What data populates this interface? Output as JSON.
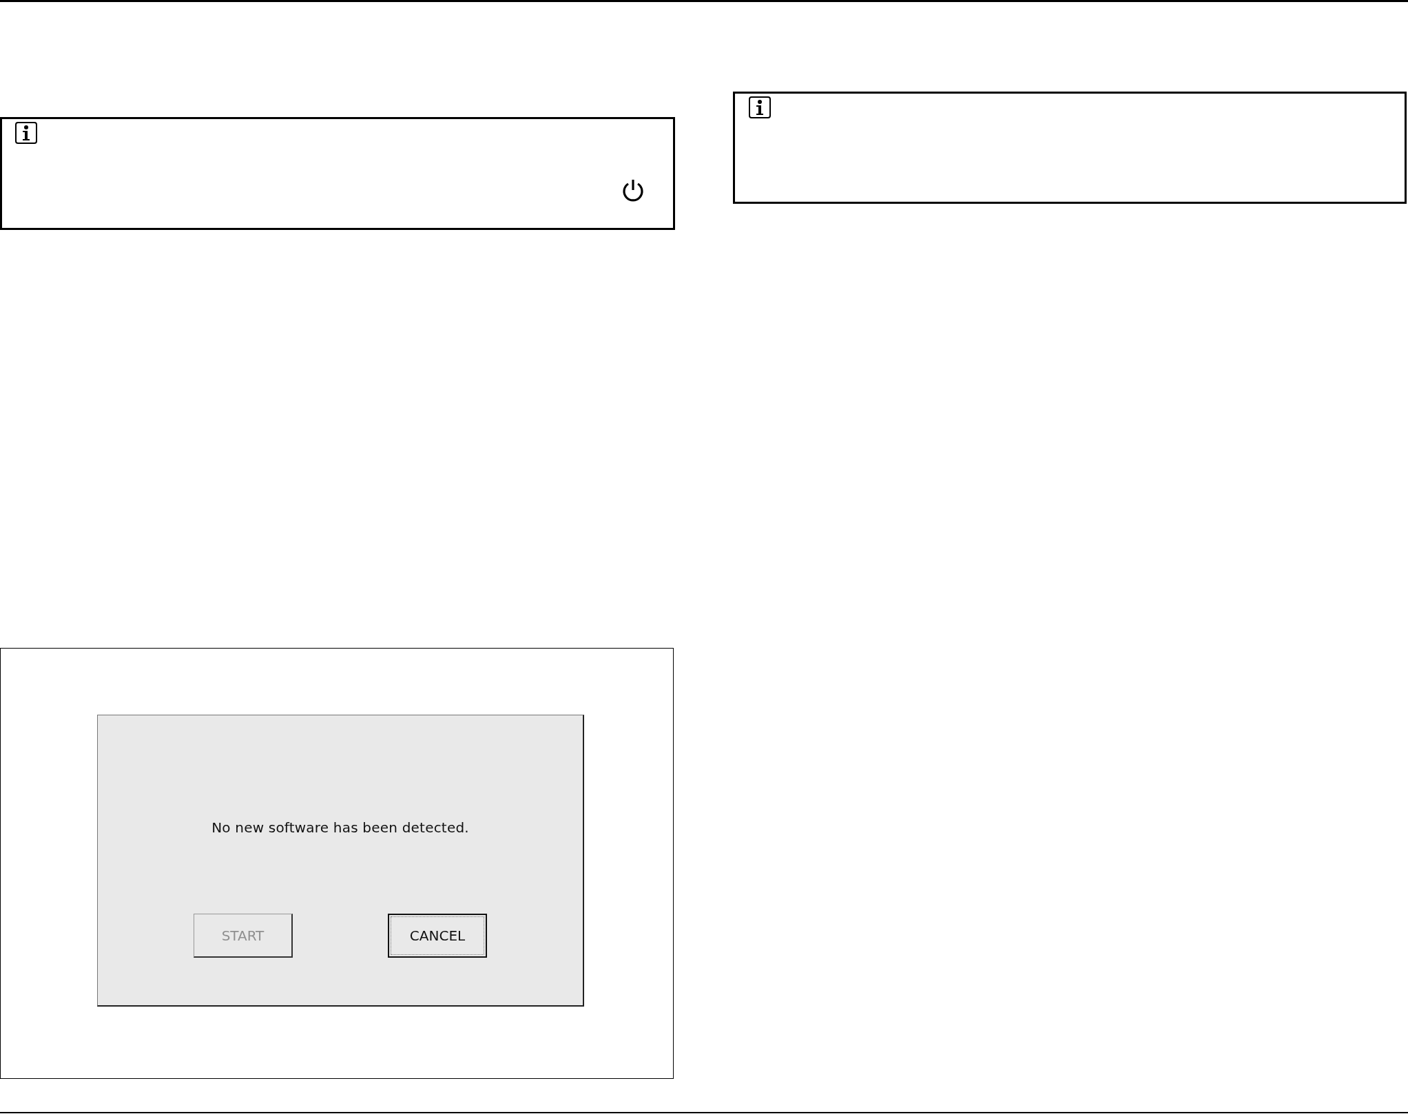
{
  "notes": [
    {
      "kind": "power"
    },
    {
      "kind": "plain"
    }
  ],
  "screen": {
    "message": "No new software has been detected.",
    "buttons": [
      {
        "label": "START",
        "disabled": true,
        "focused": false
      },
      {
        "label": "CANCEL",
        "disabled": false,
        "focused": true
      }
    ]
  }
}
